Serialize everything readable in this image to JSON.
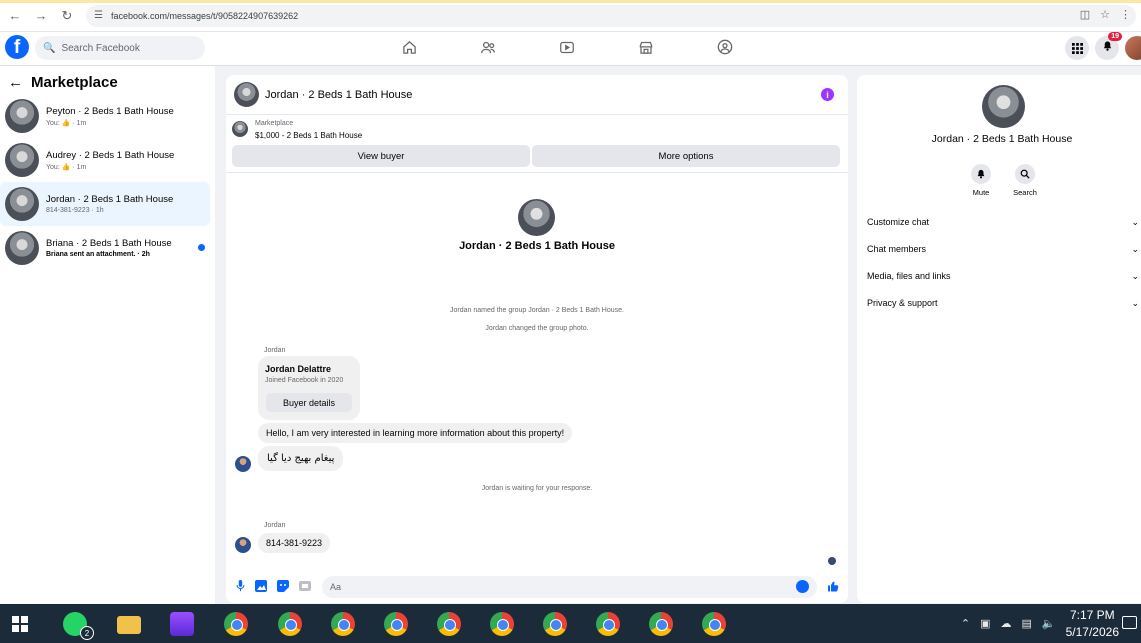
{
  "browser": {
    "url": "facebook.com/messages/t/9058224907639262"
  },
  "fb": {
    "logo_letter": "f",
    "search_placeholder": "Search Facebook",
    "notification_count": "19"
  },
  "sidebar": {
    "title": "Marketplace",
    "conversations": [
      {
        "name": "Peyton · 2 Beds 1 Bath House",
        "preview": "You: 👍 · 1m",
        "active": false,
        "unread": false
      },
      {
        "name": "Audrey · 2 Beds 1 Bath House",
        "preview": "You: 👍 · 1m",
        "active": false,
        "unread": false
      },
      {
        "name": "Jordan · 2 Beds 1 Bath House",
        "preview": "814-381-9223 · 1h",
        "active": true,
        "unread": false
      },
      {
        "name": "Briana · 2 Beds 1 Bath House",
        "preview": "Briana sent an attachment. · 2h",
        "active": false,
        "unread": true
      }
    ]
  },
  "chat": {
    "title": "Jordan · 2 Beds 1 Bath House",
    "listing": {
      "category": "Marketplace",
      "price_title": "$1,000 - 2 Beds 1 Bath House",
      "view_buyer": "View buyer",
      "more_options": "More options"
    },
    "group_title": "Jordan · 2 Beds 1 Bath House",
    "system_messages": [
      "Jordan named the group Jordan · 2 Beds 1 Bath House.",
      "Jordan changed the group photo.",
      "Jordan is waiting for your response."
    ],
    "sender_label": "Jordan",
    "buyer_card": {
      "name": "Jordan Delattre",
      "joined": "Joined Facebook in 2020",
      "button": "Buyer details"
    },
    "messages": [
      "Hello, I am very interested in learning more information about this property!",
      "پیغام بھیج دیا گیا",
      "814-381-9223"
    ],
    "composer_placeholder": "Aa"
  },
  "right_panel": {
    "title": "Jordan · 2 Beds 1 Bath House",
    "actions": [
      {
        "label": "Mute",
        "icon": "bell-icon"
      },
      {
        "label": "Search",
        "icon": "search-icon"
      }
    ],
    "menu": [
      "Customize chat",
      "Chat members",
      "Media, files and links",
      "Privacy & support"
    ]
  },
  "taskbar": {
    "whatsapp_badge": "2",
    "time": "7:17 PM",
    "date": "5/17/2026"
  },
  "colors": {
    "fb_blue": "#0866ff",
    "info_purple": "#a033ff",
    "taskbar": "#1c2b3a"
  }
}
